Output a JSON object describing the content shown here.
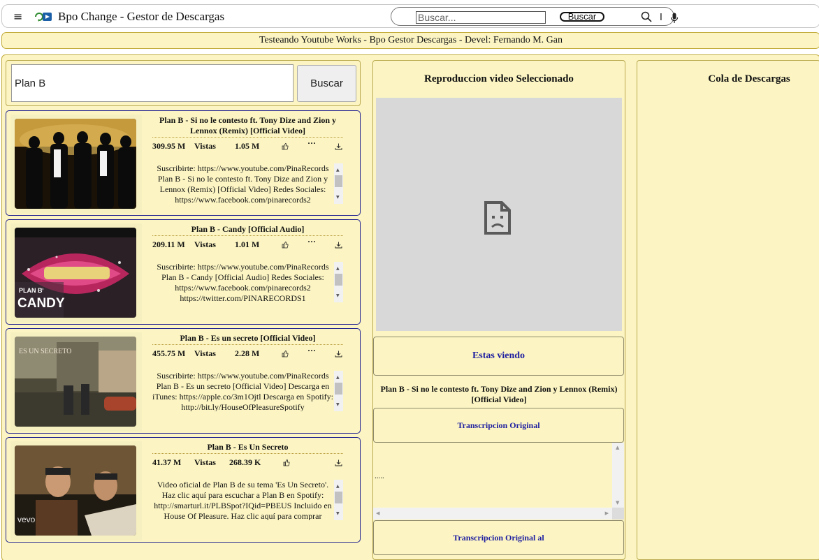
{
  "header": {
    "menu_icon": "menu-icon",
    "app_title": "Bpo Change - Gestor de Descargas",
    "search_placeholder": "Buscar...",
    "search_button": "Buscar",
    "cursor_glyph": "I"
  },
  "banner": {
    "text": "Testeando Youtube Works - Bpo Gestor Descargas - Devel: Fernando M. Gan"
  },
  "search": {
    "value": "Plan B",
    "button": "Buscar"
  },
  "results": [
    {
      "title": "Plan B - Si no le contesto ft. Tony Dize and Zion y Lennox (Remix) [Official Video]",
      "views": "309.95 M",
      "views_label": "Vistas",
      "likes": "1.05 M",
      "more": "···",
      "description": "Suscribirte: https://www.youtube.com/PinaRecords Plan B - Si no le contesto ft. Tony Dize and Zion y Lennox (Remix) [Official Video] Redes Sociales: https://www.facebook.com/pinarecords2"
    },
    {
      "title": "Plan B - Candy [Official Audio]",
      "views": "209.11 M",
      "views_label": "Vistas",
      "likes": "1.01 M",
      "more": "···",
      "description": "Suscribirte: https://www.youtube.com/PinaRecords Plan B - Candy [Official Audio] Redes Sociales: https://www.facebook.com/pinarecords2 https://twitter.com/PINARECORDS1"
    },
    {
      "title": "Plan B - Es un secreto [Official Video]",
      "views": "455.75 M",
      "views_label": "Vistas",
      "likes": "2.28 M",
      "more": "···",
      "description": "Suscribirte: https://www.youtube.com/PinaRecords Plan B - Es un secreto [Official Video] Descarga en iTunes: https://apple.co/3m1Ojtl Descarga en Spotify: http://bit.ly/HouseOfPleasureSpotify"
    },
    {
      "title": "Plan B - Es Un Secreto",
      "views": "41.37 M",
      "views_label": "Vistas",
      "likes": "268.39 K",
      "more": "···",
      "description": "Video oficial de Plan B de su tema 'Es Un Secreto'. Haz clic aquí para escuchar a Plan B en Spotify: http://smarturl.it/PLBSpot?IQid=PBEUS Incluido en House Of Pleasure. Haz clic aquí para comprar"
    }
  ],
  "thumb_text": {
    "candy_brand": "PLAN B",
    "candy_word": "CANDY",
    "secreto_word": "ES UN SECRETO",
    "vevo": "vevo"
  },
  "player": {
    "heading": "Reproduccion video Seleccionado",
    "now_label": "Estas viendo",
    "now_title": "Plan B - Si no le contesto ft. Tony Dize and Zion y Lennox (Remix) [Official Video]",
    "transcript_label": "Transcripcion Original",
    "transcript_text": ".....",
    "transcript_al_label": "Transcripcion Original al"
  },
  "queue": {
    "heading": "Cola de Descargas"
  },
  "colors": {
    "panel": "#fcf5c3",
    "border": "#c2ab3a",
    "link_blue": "#1f1fa0",
    "card_border": "#1f1f8f"
  }
}
